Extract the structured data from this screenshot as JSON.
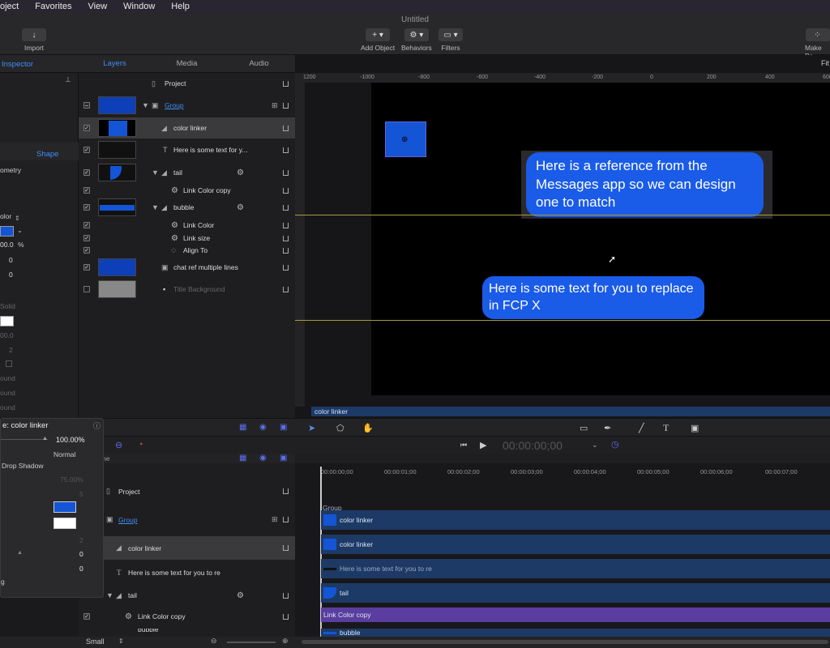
{
  "menu": [
    "oject",
    "Favorites",
    "View",
    "Window",
    "Help"
  ],
  "toolbar": {
    "title": "Untitled",
    "import": "Import",
    "add_object": "Add Object",
    "behaviors": "Behaviors",
    "filters": "Filters",
    "make_pa": "Make Pa"
  },
  "inspector": {
    "tab": "Inspector",
    "shape_tab": "Shape",
    "geometry": "ometry",
    "color": "olor",
    "pct": "00.0",
    "v1": "0",
    "v2": "0",
    "solid": "Solid",
    "pct2": "00.0",
    "two": "2",
    "round1": "ound",
    "round2": "ound",
    "round3": "ound"
  },
  "layers": {
    "tabs": [
      "Layers",
      "Media",
      "Audio"
    ],
    "rows": [
      {
        "name": "Project"
      },
      {
        "name": "Group"
      },
      {
        "name": "color linker"
      },
      {
        "name": "Here is some text for y..."
      },
      {
        "name": "tail"
      },
      {
        "name": "Link Color copy"
      },
      {
        "name": "bubble"
      },
      {
        "name": "Link Color"
      },
      {
        "name": "Link size"
      },
      {
        "name": "Align To"
      },
      {
        "name": "chat ref multiple lines"
      },
      {
        "name": "Title Background"
      }
    ]
  },
  "canvas": {
    "fit": "Fit",
    "ruler": [
      "1200",
      "-1000",
      "-800",
      "-600",
      "-400",
      "-200",
      "0",
      "200",
      "400",
      "600"
    ],
    "bubble1": "Here is a reference from the Messages app so we can design one to match",
    "bubble2": "Here is some text for you to replace in FCP X",
    "status_label": "color linker"
  },
  "hud": {
    "title": "e: color linker",
    "opacity": "100.00%",
    "blend": "Normal",
    "drop_shadow": "Drop Shadow",
    "shadow_pct": "75.00%",
    "five": "5",
    "two": "2",
    "zero1": "0",
    "zero2": "0"
  },
  "transport": {
    "timecode": "00:00:00;00"
  },
  "timeline": {
    "ticks": [
      "00:00:00;00",
      "00:00:01;00",
      "00:00:02;00",
      "00:00:03;00",
      "00:00:04;00",
      "00:00:05;00",
      "00:00:06;00",
      "00:00:07;00"
    ],
    "group_label": "Group",
    "search_frag": "ne",
    "rows": [
      {
        "name": "Project"
      },
      {
        "name": "Group"
      },
      {
        "name": "color linker"
      },
      {
        "name": "Here is some text for you to re"
      },
      {
        "name": "tail"
      },
      {
        "name": "Link Color copy"
      },
      {
        "name": "bubble"
      }
    ],
    "bars": [
      {
        "name": "color linker"
      },
      {
        "name": "color linker"
      },
      {
        "name": "Here is some text for you to re"
      },
      {
        "name": "tail"
      },
      {
        "name": "Link Color copy"
      },
      {
        "name": "bubble"
      }
    ]
  },
  "bottom": {
    "size": "Small"
  }
}
